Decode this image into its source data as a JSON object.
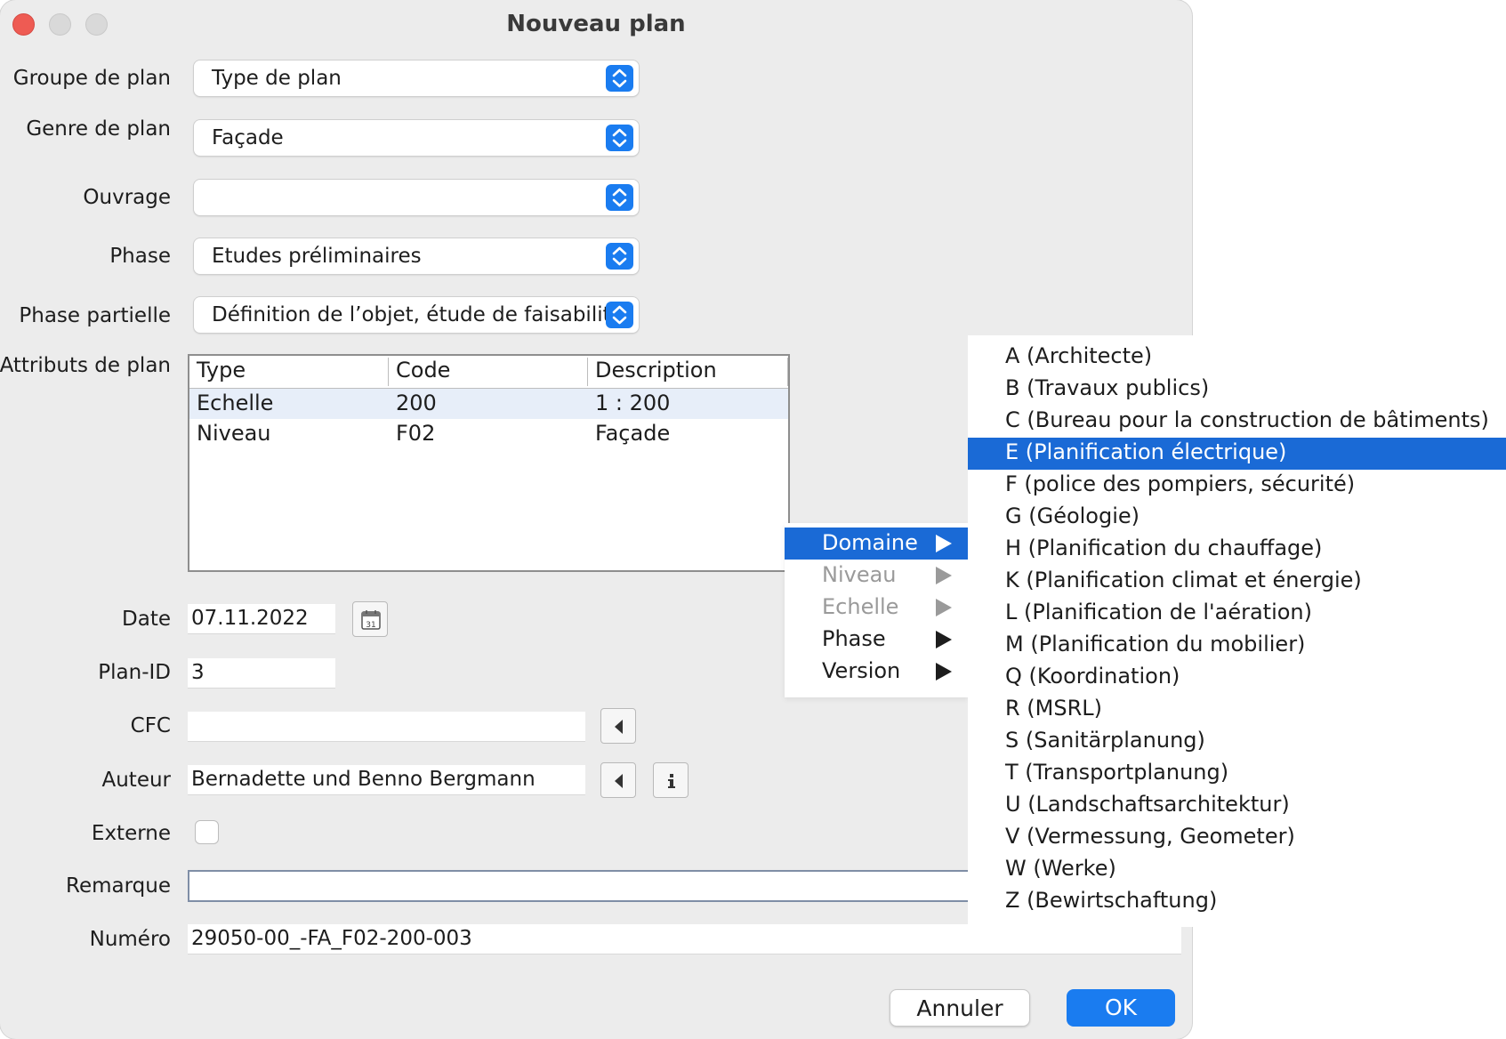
{
  "window": {
    "title": "Nouveau plan"
  },
  "form": {
    "groupe_label": "Groupe de plan",
    "groupe_value": "Type de plan",
    "genre_label": "Genre de plan",
    "genre_value": "Façade",
    "ouvrage_label": "Ouvrage",
    "ouvrage_value": "",
    "phase_label": "Phase",
    "phase_value": "Etudes préliminaires",
    "phase_partielle_label": "Phase partielle",
    "phase_partielle_value": "Définition de l’objet, étude de faisabilité",
    "attributs_label": "Attributs de plan",
    "date_label": "Date",
    "date_value": "07.11.2022",
    "planid_label": "Plan-ID",
    "planid_value": "3",
    "cfc_label": "CFC",
    "cfc_value": "",
    "auteur_label": "Auteur",
    "auteur_value": "Bernadette und Benno Bergmann",
    "externe_label": "Externe",
    "externe_checked": false,
    "remarque_label": "Remarque",
    "remarque_value": "",
    "numero_label": "Numéro",
    "numero_value": "29050-00_-FA_F02-200-003"
  },
  "table": {
    "headers": [
      "Type",
      "Code",
      "Description"
    ],
    "rows": [
      [
        "Echelle",
        "200",
        "1 : 200"
      ],
      [
        "Niveau",
        "F02",
        "Façade"
      ]
    ]
  },
  "buttons": {
    "cancel": "Annuler",
    "ok": "OK"
  },
  "context_menu": {
    "items": [
      "Domaine",
      "Niveau",
      "Echelle",
      "Phase",
      "Version"
    ],
    "active": "Domaine",
    "disabled": [
      "Niveau",
      "Echelle"
    ]
  },
  "submenu": {
    "items": [
      "A (Architecte)",
      "B (Travaux publics)",
      "C (Bureau pour la construction de bâtiments)",
      "E (Planification électrique)",
      "F (police des pompiers, sécurité)",
      "G (Géologie)",
      "H (Planification du chauffage)",
      "K (Planification climat et énergie)",
      "L (Planification de l'aération)",
      "M (Planification du mobilier)",
      "Q (Koordination)",
      "R (MSRL)",
      "S (Sanitärplanung)",
      "T (Transportplanung)",
      "U (Landschaftsarchitektur)",
      "V (Vermessung, Geometer)",
      "W (Werke)",
      "Z (Bewirtschaftung)"
    ],
    "highlighted": "E (Planification électrique)"
  },
  "colors": {
    "accent": "#1a7cf0",
    "menu_highlight": "#1a6ad6",
    "window_bg": "#ececec"
  }
}
